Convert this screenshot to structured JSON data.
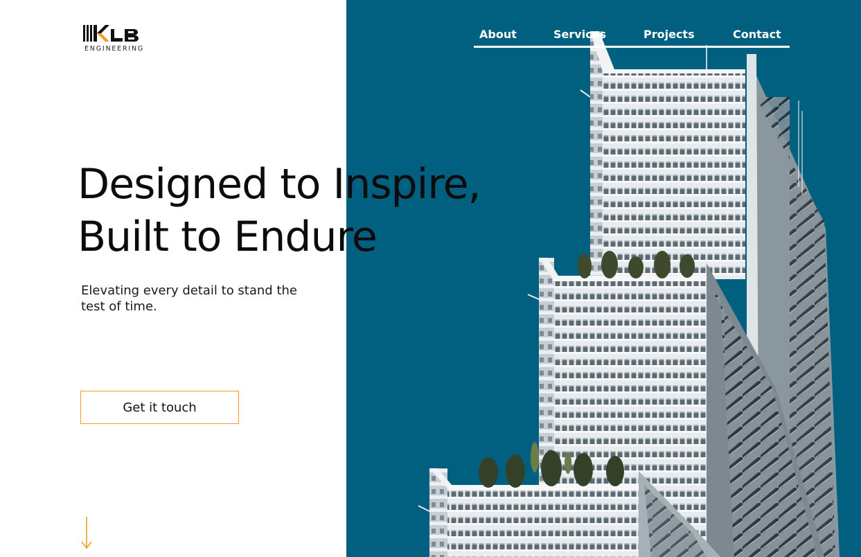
{
  "brand": {
    "logo_text": "KLB",
    "logo_subtitle": "ENGINEERING",
    "accent_color": "#f29b2b",
    "panel_color": "#015f7f"
  },
  "nav": {
    "items": [
      {
        "label": "About"
      },
      {
        "label": "Services"
      },
      {
        "label": "Projects"
      },
      {
        "label": "Contact"
      }
    ]
  },
  "hero": {
    "title_line_1": "Designed to Inspire,",
    "title_line_2": "Built to Endure",
    "subtitle": "Elevating every detail to stand the test of time.",
    "cta_label": "Get it touch"
  },
  "icons": {
    "scroll": "arrow-down-icon",
    "building": "building-photo"
  }
}
